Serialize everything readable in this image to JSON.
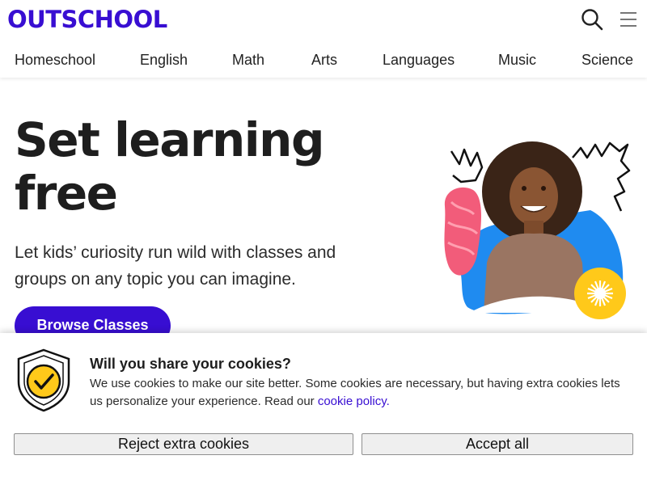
{
  "header": {
    "logo_text": "OUTSCHOOL",
    "search_icon": "search-icon",
    "menu_icon": "hamburger-menu-icon",
    "nav": [
      {
        "label": "Homeschool"
      },
      {
        "label": "English"
      },
      {
        "label": "Math"
      },
      {
        "label": "Arts"
      },
      {
        "label": "Languages"
      },
      {
        "label": "Music"
      },
      {
        "label": "Science"
      }
    ]
  },
  "hero": {
    "title_line1": "Set learning",
    "title_line2": "free",
    "subtitle": "Let kids’ curiosity run wild with classes and groups on any topic you can imagine.",
    "cta_label": "Browse Classes"
  },
  "cookie_banner": {
    "icon": "shield-check-icon",
    "title": "Will you share your cookies?",
    "text": "We use cookies to make our site better. Some cookies are necessary, but having extra cookies lets us personalize your experience. Read our ",
    "link_text": "cookie policy.",
    "reject_label": "Reject extra cookies",
    "accept_label": "Accept all"
  },
  "colors": {
    "brand": "#380ed2",
    "accent_yellow": "#ffc91a",
    "accent_blue": "#1f8bf0",
    "accent_pink": "#f25c7a"
  }
}
